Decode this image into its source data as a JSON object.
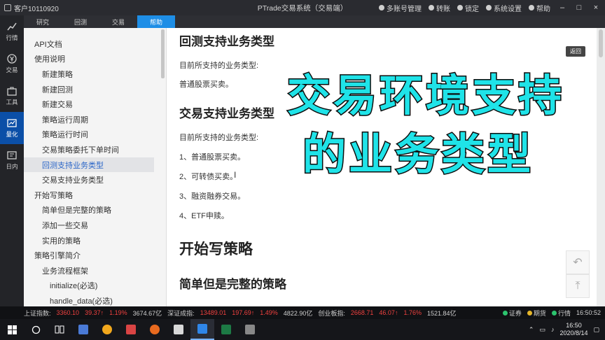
{
  "titlebar": {
    "user": "客户10110920",
    "title": "PTrade交易系统（交易端）",
    "menu": [
      "多账号管理",
      "转账",
      "锁定",
      "系统设置",
      "帮助"
    ]
  },
  "leftbar": [
    {
      "label": "行情",
      "icon": "chart-icon"
    },
    {
      "label": "交易",
      "icon": "yen-icon"
    },
    {
      "label": "工具",
      "icon": "toolbox-icon"
    },
    {
      "label": "量化",
      "icon": "quant-icon",
      "active": true
    },
    {
      "label": "日内",
      "icon": "intraday-icon"
    }
  ],
  "tabs": [
    "研究",
    "回测",
    "交易",
    "帮助"
  ],
  "active_tab": "帮助",
  "nav": [
    {
      "label": "API文档",
      "level": 0
    },
    {
      "label": "使用说明",
      "level": 0
    },
    {
      "label": "新建策略",
      "level": 1
    },
    {
      "label": "新建回测",
      "level": 1
    },
    {
      "label": "新建交易",
      "level": 1
    },
    {
      "label": "策略运行周期",
      "level": 1
    },
    {
      "label": "策略运行时间",
      "level": 1
    },
    {
      "label": "交易策略委托下单时间",
      "level": 1
    },
    {
      "label": "回测支持业务类型",
      "level": 1,
      "selected": true
    },
    {
      "label": "交易支持业务类型",
      "level": 1
    },
    {
      "label": "开始写策略",
      "level": 0
    },
    {
      "label": "简单但是完整的策略",
      "level": 1
    },
    {
      "label": "添加一些交易",
      "level": 1
    },
    {
      "label": "实用的策略",
      "level": 1
    },
    {
      "label": "策略引擎简介",
      "level": 0
    },
    {
      "label": "业务流程框架",
      "level": 1
    },
    {
      "label": "initialize(必选)",
      "level": 2
    },
    {
      "label": "handle_data(必选)",
      "level": 2
    }
  ],
  "content": {
    "h_backtest": "回测支持业务类型",
    "p_supported1": "目前所支持的业务类型:",
    "p_stock1": "普通股票买卖。",
    "h_trade": "交易支持业务类型",
    "p_supported2": "目前所支持的业务类型:",
    "items": [
      "1、普通股票买卖。",
      "2、可转债买卖。",
      "3、融资融券交易。",
      "4、ETF申赎。"
    ],
    "h_start": "开始写策略",
    "h_simple": "简单但是完整的策略",
    "back_label": "返回"
  },
  "overlay": {
    "line1": "交易环境支持",
    "line2": "的业务类型"
  },
  "ticker": {
    "sh_label": "上证指数:",
    "sh_value": "3360.10",
    "sh_change": "39.37",
    "sh_pct": "1.19%",
    "sh_amount": "3674.67亿",
    "sz_label": "深证成指:",
    "sz_value": "13489.01",
    "sz_change": "197.69",
    "sz_pct": "1.49%",
    "sz_amount": "4822.90亿",
    "cy_label": "创业板指:",
    "cy_value": "2668.71",
    "cy_change": "46.07",
    "cy_pct": "1.76%",
    "cy_amount": "1521.84亿",
    "status": [
      "证券",
      "期货",
      "行情"
    ],
    "time": "16:50:52"
  },
  "taskbar": {
    "time": "16:50",
    "date": "2020/8/14"
  }
}
